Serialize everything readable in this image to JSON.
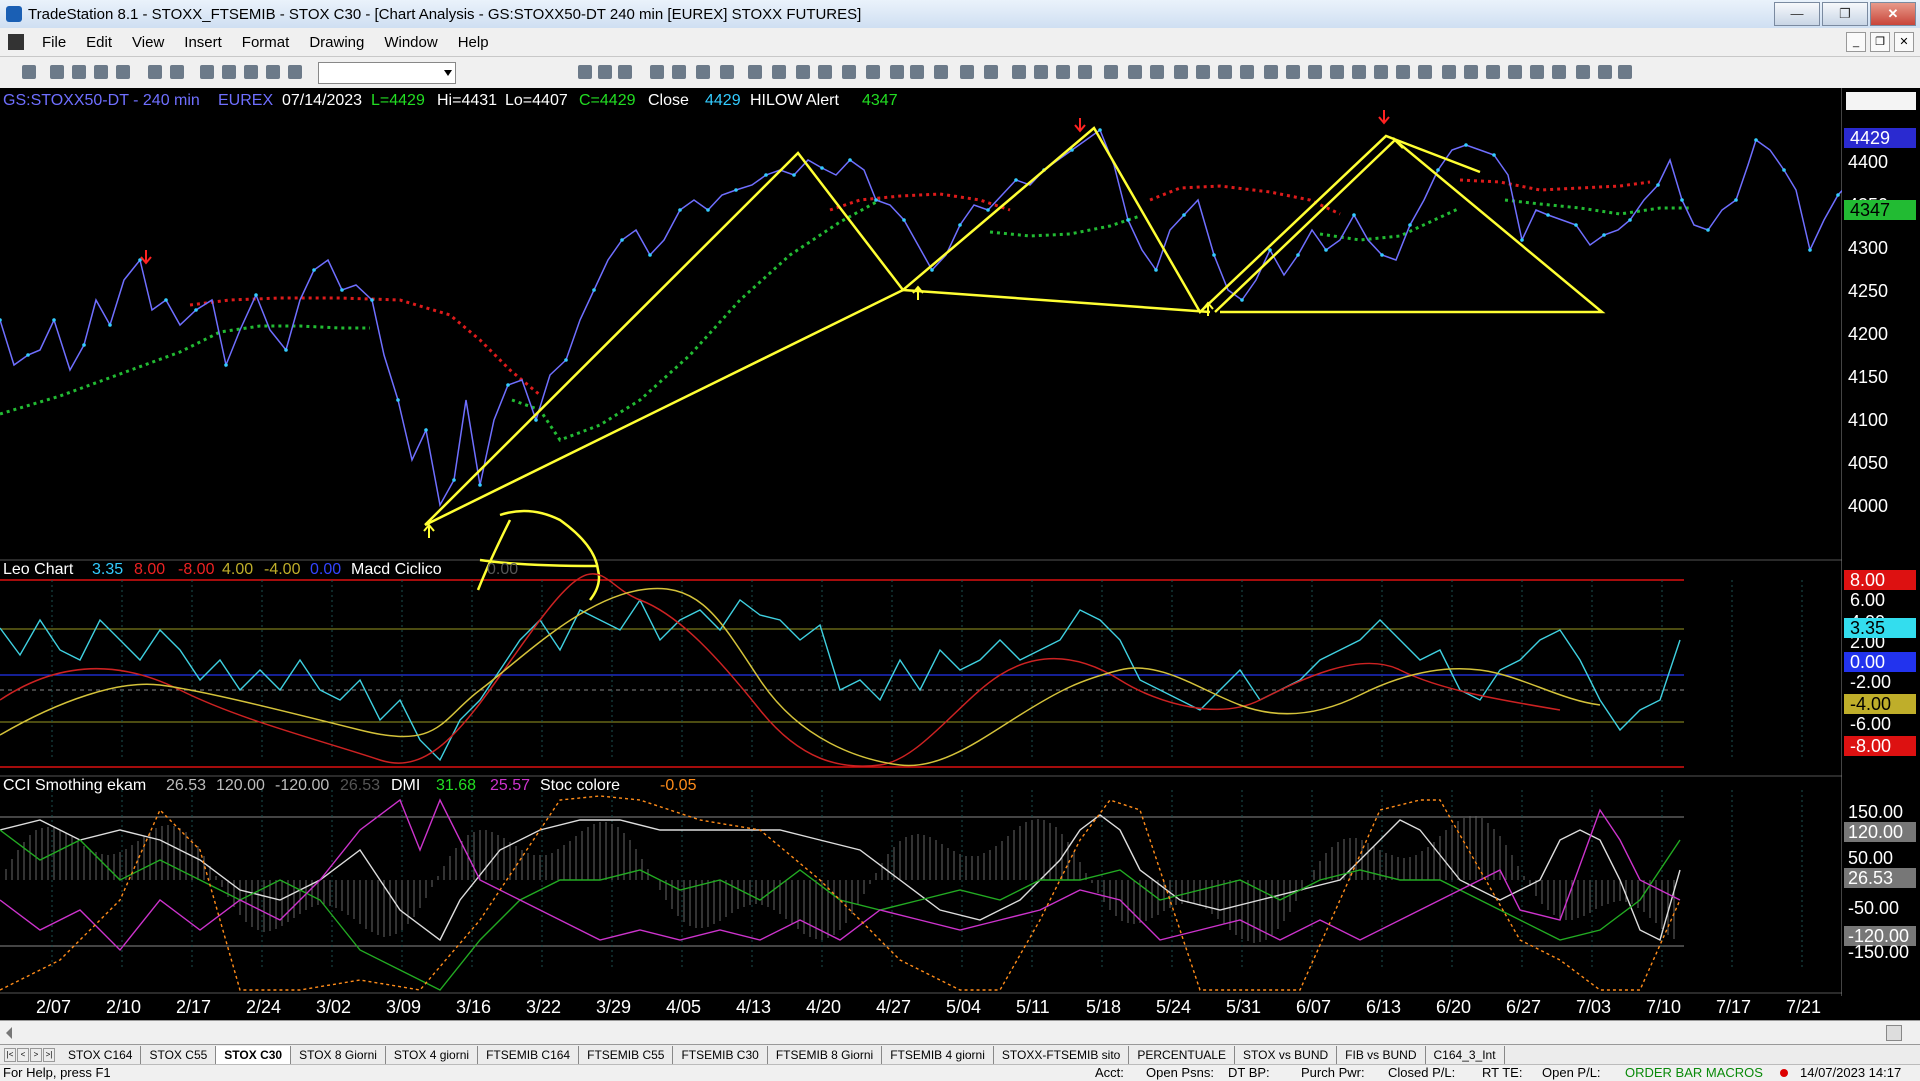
{
  "window": {
    "title": "TradeStation 8.1 - STOXX_FTSEMIB - STOX  C30 - [Chart Analysis - GS:STOXX50-DT  240 min  [EUREX] STOXX FUTURES]"
  },
  "menu": [
    "File",
    "Edit",
    "View",
    "Insert",
    "Format",
    "Drawing",
    "Window",
    "Help"
  ],
  "chart_header": {
    "symbol": "GS:STOXX50-DT - 240 min",
    "exchange": "EUREX",
    "date": "07/14/2023",
    "last": "L=4429",
    "hi": "Hi=4431",
    "lo": "Lo=4407",
    "close_c": "C=4429",
    "close_label": "Close",
    "close_val": "4429",
    "alert_label": "HILOW Alert",
    "alert_val": "4347"
  },
  "leo_header": {
    "name": "Leo Chart",
    "v1": "3.35",
    "v2": "8.00",
    "v3": "-8.00",
    "v4": "4.00",
    "v5": "-4.00",
    "v6": "0.00",
    "macd": "Macd Ciclico",
    "macd_val": "0.00"
  },
  "cci_header": {
    "name": "CCI Smothing ekam",
    "v1": "26.53",
    "v2": "120.00",
    "v3": "-120.00",
    "v4": "26.53",
    "dmi": "DMI",
    "dmi1": "31.68",
    "dmi2": "25.57",
    "stoc": "Stoc colore",
    "stoc_val": "-0.05"
  },
  "price_axis": [
    "4400",
    "4350",
    "4300",
    "4250",
    "4200",
    "4150",
    "4100",
    "4050",
    "4000"
  ],
  "price_markers": {
    "last": "4429",
    "alert": "4347"
  },
  "leo_axis": [
    "8.00",
    "6.00",
    "4.00",
    "2.00",
    "3.35",
    "0.00",
    "-2.00",
    "-4.00",
    "-6.00",
    "-8.00"
  ],
  "cci_axis": [
    "150.00",
    "120.00",
    "50.00",
    "26.53",
    "-50.00",
    "-120.00",
    "-150.00"
  ],
  "dates": [
    "2/07",
    "2/10",
    "2/17",
    "2/24",
    "3/02",
    "3/09",
    "3/16",
    "3/22",
    "3/29",
    "4/05",
    "4/13",
    "4/20",
    "4/27",
    "5/04",
    "5/11",
    "5/18",
    "5/24",
    "5/31",
    "6/07",
    "6/13",
    "6/20",
    "6/27",
    "7/03",
    "7/10",
    "7/17",
    "7/21"
  ],
  "tabs": [
    "STOX C164",
    "STOX C55",
    "STOX C30",
    "STOX 8 Giorni",
    "STOX 4 giorni",
    "FTSEMIB C164",
    "FTSEMIB C55",
    "FTSEMIB C30",
    "FTSEMIB 8 Giorni",
    "FTSEMIB 4 giorni",
    "STOXX-FTSEMIB sito",
    "PERCENTUALE",
    "STOX vs BUND",
    "FIB vs BUND",
    "C164_3_Int"
  ],
  "active_tab": 2,
  "status": {
    "help": "For Help, press F1",
    "acct": "Acct:",
    "open_psns": "Open Psns:",
    "dt_bp": "DT BP:",
    "purch_pwr": "Purch Pwr:",
    "closed_pl": "Closed P/L:",
    "rt_te": "RT TE:",
    "open_pl": "Open P/L:",
    "macros": "ORDER BAR  MACROS",
    "datetime": "14/07/2023 14:17"
  },
  "colors": {
    "price": "#6f6fff",
    "dots": "#33ccff",
    "hilow_red": "#dd1b1b",
    "hilow_green": "#22bb33",
    "trend": "#ffff33",
    "leo_cyan": "#3fd0e0",
    "leo_red": "#cc2222",
    "leo_yellow": "#d4c23a",
    "cci_white": "#dddddd",
    "cci_green": "#22aa22",
    "cci_magenta": "#cc33cc",
    "cci_orange": "#ff8c1a"
  }
}
